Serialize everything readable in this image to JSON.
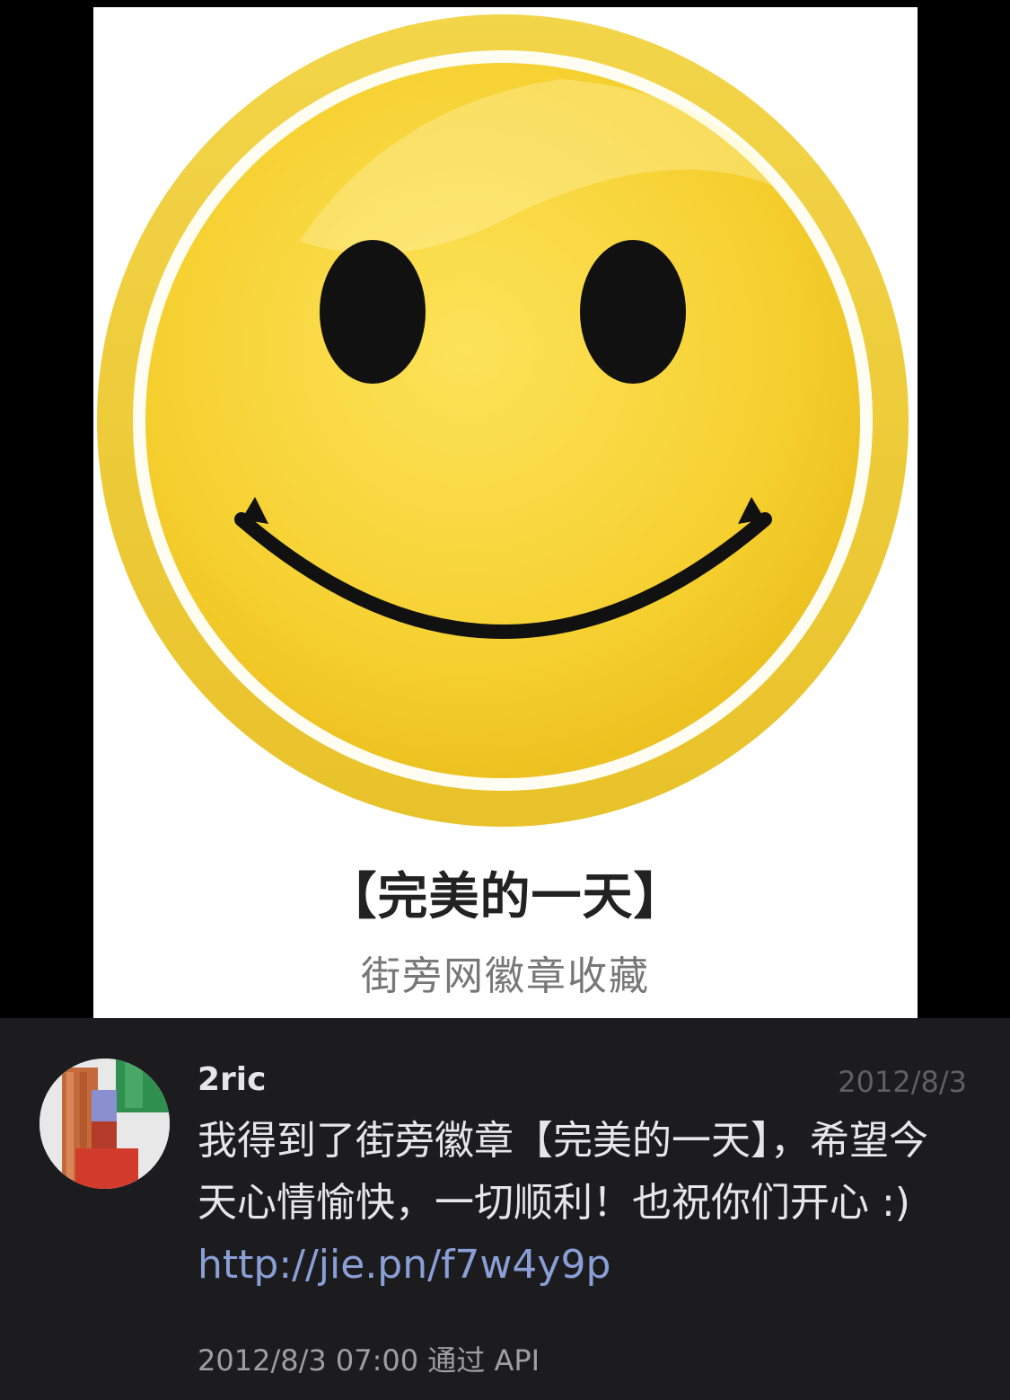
{
  "badge": {
    "title": "【完美的一天】",
    "subtitle": "街旁网徽章收藏",
    "icon": "smiley-face-icon"
  },
  "post": {
    "username": "2ric",
    "date": "2012/8/3",
    "text": "我得到了街旁徽章【完美的一天】，希望今天心情愉快，一切顺利！也祝你们开心 :) ",
    "link": "http://jie.pn/f7w4y9p",
    "timestamp": "2012/8/3 07:00",
    "via_label": "通过",
    "source": "API"
  },
  "colors": {
    "background": "#1c1c1e",
    "link": "#8a9fd6",
    "badge_yellow": "#f6d83c"
  }
}
